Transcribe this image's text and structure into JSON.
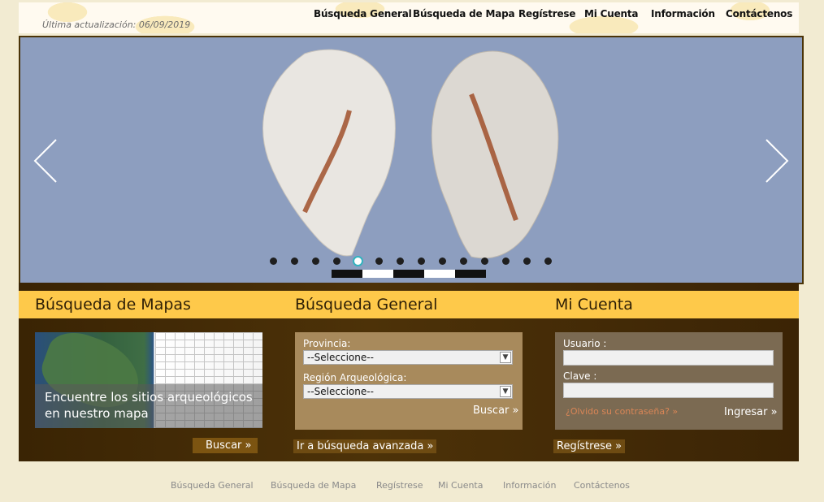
{
  "header": {
    "updated": "Última actualización: 06/09/2019",
    "nav": [
      "Búsqueda General",
      "Búsqueda de Mapa",
      "Regístrese",
      "Mi Cuenta",
      "Información",
      "Contáctenos"
    ]
  },
  "slider": {
    "slide_count": 14,
    "active_index": 4,
    "dot_active_color": "#33b3bf",
    "background": "#8d9ebf"
  },
  "sections": {
    "maps": {
      "title": "Búsqueda de Mapas",
      "caption_line1": "Encuentre los sitios arqueológicos",
      "caption_line2": "en nuestro mapa",
      "button": "Buscar »"
    },
    "general": {
      "title": "Búsqueda General",
      "province_label": "Provincia:",
      "province_value": "--Seleccione--",
      "region_label": "Región Arqueológica:",
      "region_value": "--Seleccione--",
      "search_button": "Buscar »",
      "advanced_link": "Ir a búsqueda avanzada »"
    },
    "account": {
      "title": "Mi Cuenta",
      "user_label": "Usuario :",
      "password_label": "Clave :",
      "forgot_link": "¿Olvido su contraseña? »",
      "login_button": "Ingresar »",
      "register_link": "Regístrese »"
    }
  },
  "footer": {
    "nav": [
      "Búsqueda General",
      "Búsqueda de Mapa",
      "Regístrese",
      "Mi Cuenta",
      "Información",
      "Contáctenos"
    ]
  },
  "colors": {
    "accent_strip": "#fec94a",
    "panel_dark": "#3a2404",
    "page_bg": "#f2ebd2"
  }
}
